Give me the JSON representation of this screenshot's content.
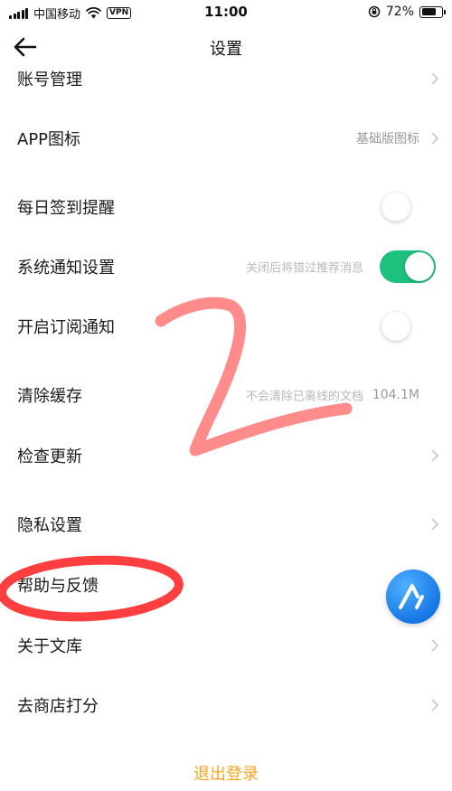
{
  "status_bar": {
    "carrier": "中国移动",
    "vpn": "VPN",
    "time": "11:00",
    "battery": "72%",
    "battery_level": 0.72
  },
  "nav": {
    "title": "设置"
  },
  "rows": [
    {
      "label": "账号管理"
    },
    {
      "label": "APP图标",
      "value": "基础版图标"
    },
    {
      "label": "每日签到提醒",
      "toggle": false
    },
    {
      "label": "系统通知设置",
      "hint": "关闭后将错过推荐消息",
      "toggle": true
    },
    {
      "label": "开启订阅通知",
      "toggle": false
    },
    {
      "label": "清除缓存",
      "hint": "不会清除已离线的文档",
      "value": "104.1M"
    },
    {
      "label": "检查更新"
    },
    {
      "label": "隐私设置"
    },
    {
      "label": "帮助与反馈"
    },
    {
      "label": "关于文库"
    },
    {
      "label": "去商店打分"
    }
  ],
  "logout_label": "退出登录",
  "colors": {
    "toggle_on": "#1fc17f",
    "logout": "#f5a623",
    "annotation_red": "#ff2a2a"
  },
  "icons": {
    "back": "arrow-left-icon",
    "chevron": "chevron-right-icon",
    "fab": "assistant-logo-icon"
  }
}
